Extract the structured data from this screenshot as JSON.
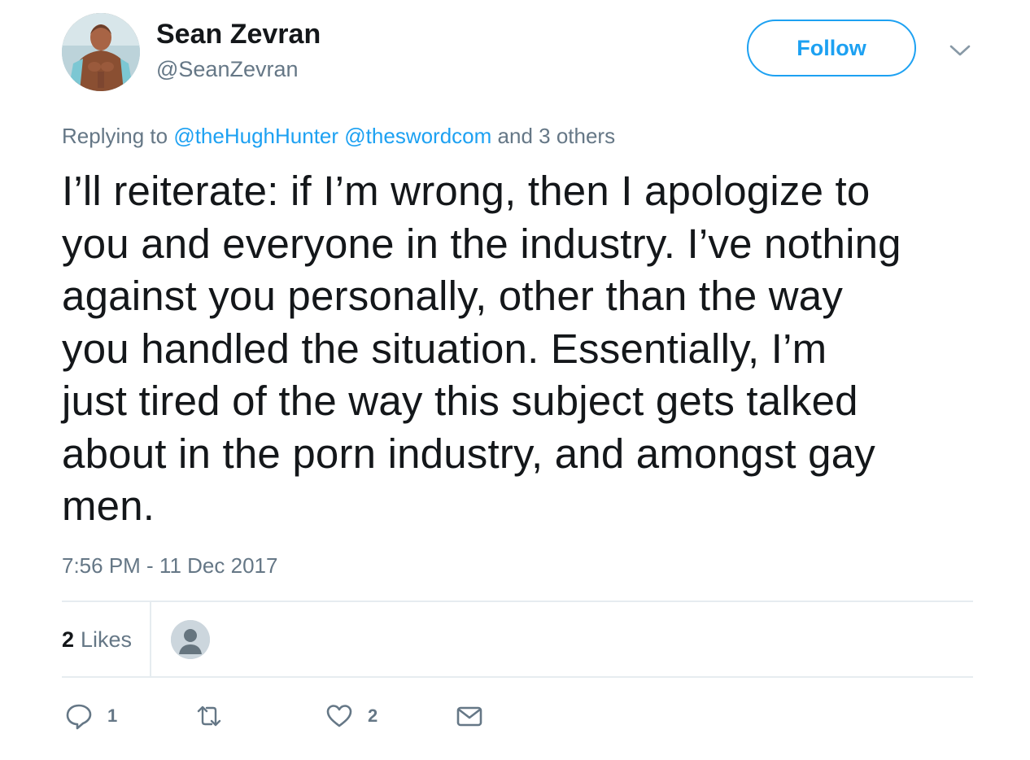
{
  "user": {
    "display_name": "Sean Zevran",
    "handle": "@SeanZevran",
    "avatar_icon": "profile-photo"
  },
  "header": {
    "follow_label": "Follow",
    "menu_icon": "chevron-down-icon"
  },
  "reply": {
    "prefix": "Replying to",
    "mentions": [
      "@theHughHunter",
      "@theswordcom"
    ],
    "suffix": "and 3 others"
  },
  "tweet": {
    "lines": [
      "I’ll reiterate: if I’m wrong, then I apologize to",
      "you and everyone in the industry. I’ve nothing",
      "against you personally, other than the way",
      "you handled the situation. Essentially, I’m",
      "just tired of the way this subject gets talked",
      "about in the porn industry, and amongst gay",
      "men."
    ],
    "timestamp": "7:56 PM - 11 Dec 2017"
  },
  "stats": {
    "likes_count": "2",
    "likes_label": "Likes"
  },
  "actions": {
    "reply_count": "1",
    "retweet_count": "",
    "like_count": "2"
  },
  "colors": {
    "accent": "#1da1f2",
    "text": "#14171a",
    "secondary": "#657786",
    "divider": "#e6ecf0"
  }
}
